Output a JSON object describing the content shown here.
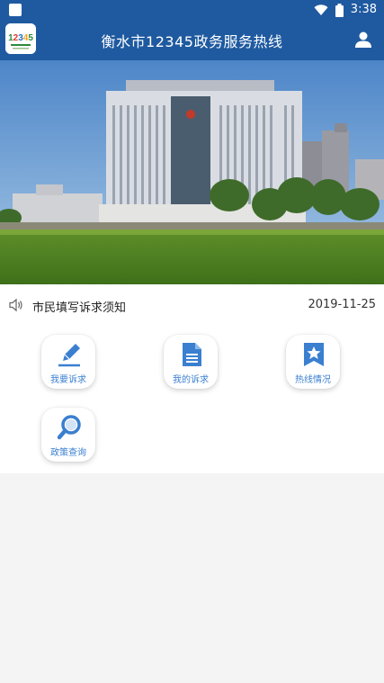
{
  "status_bar": {
    "time": "3:38"
  },
  "header": {
    "logo_text": "12345",
    "title": "衡水市12345政务服务热线",
    "user_icon": "user-icon"
  },
  "notice": {
    "icon": "speaker-icon",
    "text": "市民填写诉求须知",
    "date": "2019-11-25"
  },
  "menu": [
    {
      "icon": "pencil-icon",
      "label": "我要诉求"
    },
    {
      "icon": "document-icon",
      "label": "我的诉求"
    },
    {
      "icon": "star-icon",
      "label": "热线情况"
    },
    {
      "icon": "magnifier-icon",
      "label": "政策查询"
    }
  ],
  "colors": {
    "primary": "#1f5aa0",
    "accent": "#3a7fd0",
    "background": "#f4f4f4"
  }
}
